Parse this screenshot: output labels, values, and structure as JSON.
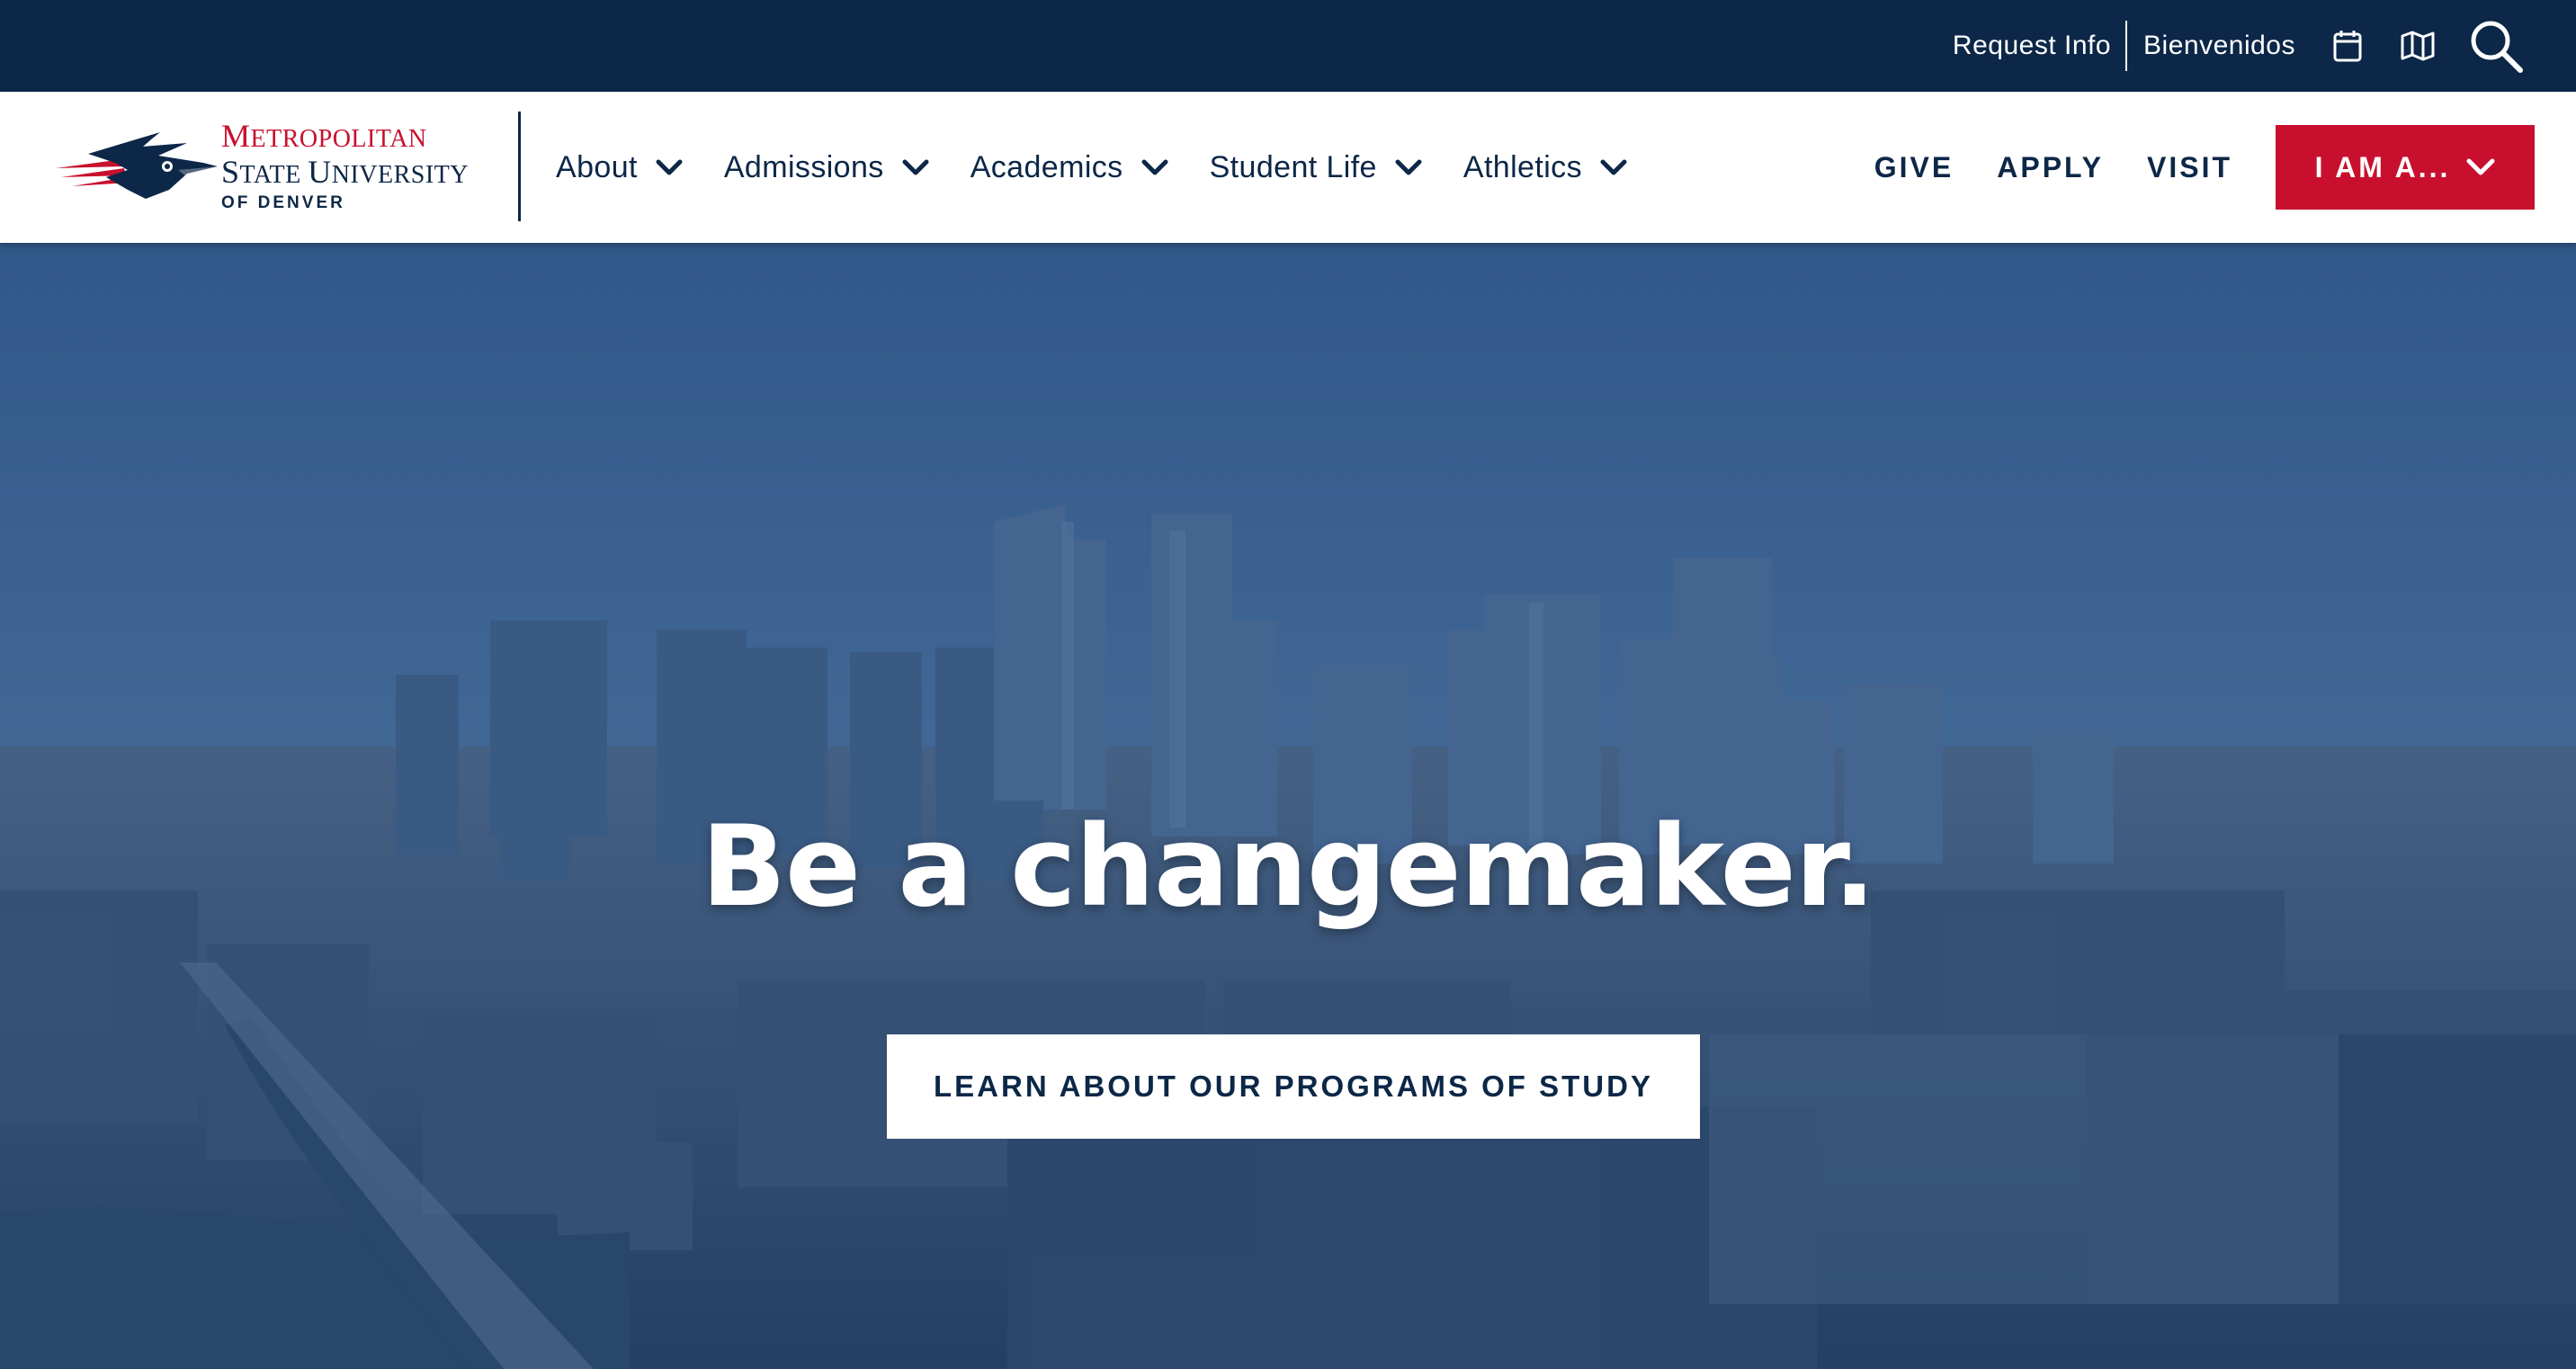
{
  "utility": {
    "request_info": "Request Info",
    "bienvenidos": "Bienvenidos",
    "icons": [
      "calendar-icon",
      "map-icon",
      "search-icon"
    ]
  },
  "logo": {
    "line1_cap": "M",
    "line1_rest": "ETROPOLITAN",
    "line2_cap1": "S",
    "line2_rest1": "TATE ",
    "line2_cap2": "U",
    "line2_rest2": "NIVERSITY",
    "line3": "OF DENVER"
  },
  "nav": {
    "items": [
      {
        "label": "About"
      },
      {
        "label": "Admissions"
      },
      {
        "label": "Academics"
      },
      {
        "label": "Student Life"
      },
      {
        "label": "Athletics"
      }
    ],
    "give": "GIVE",
    "apply": "APPLY",
    "visit": "VISIT",
    "iam": "I AM A..."
  },
  "hero": {
    "headline": "Be a changemaker.",
    "button": "LEARN ABOUT OUR PROGRAMS OF STUDY"
  },
  "colors": {
    "navy": "#0c2747",
    "red": "#c8102e",
    "white": "#ffffff"
  }
}
